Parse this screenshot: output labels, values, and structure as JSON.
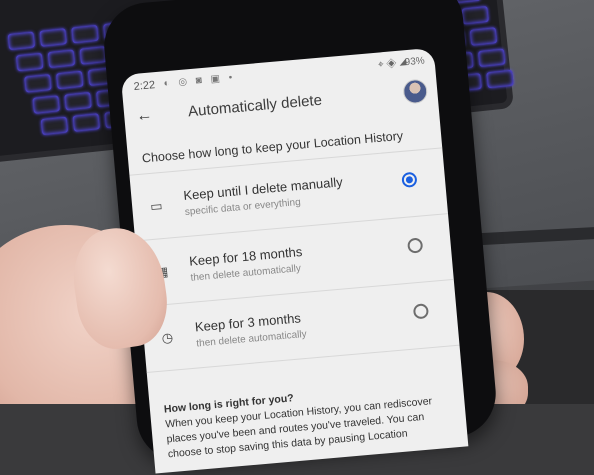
{
  "status": {
    "time": "2:22",
    "notif_icons": "◐ ◎ ◙ ▣ •",
    "sys_icons": "⌖ ◈ ◢",
    "battery": "93%"
  },
  "app": {
    "back_glyph": "←",
    "title": "Automatically delete"
  },
  "heading": "Choose how long to keep your Location History",
  "options": [
    {
      "label": "Keep until I delete manually",
      "sub": "specific data or everything",
      "icon": "briefcase-icon",
      "icon_glyph": "▭",
      "selected": true
    },
    {
      "label": "Keep for 18 months",
      "sub": "then delete automatically",
      "icon": "calendar-icon",
      "icon_glyph": "▦",
      "selected": false
    },
    {
      "label": "Keep for 3 months",
      "sub": "then delete automatically",
      "icon": "clock-icon",
      "icon_glyph": "◷",
      "selected": false
    }
  ],
  "info": {
    "question": "How long is right for you?",
    "body": "When you keep your Location History, you can rediscover places you've been and routes you've traveled. You can choose to stop saving this data by pausing Location"
  },
  "colors": {
    "accent": "#1a5fe0",
    "keyboard_glow": "#5a4cff"
  }
}
